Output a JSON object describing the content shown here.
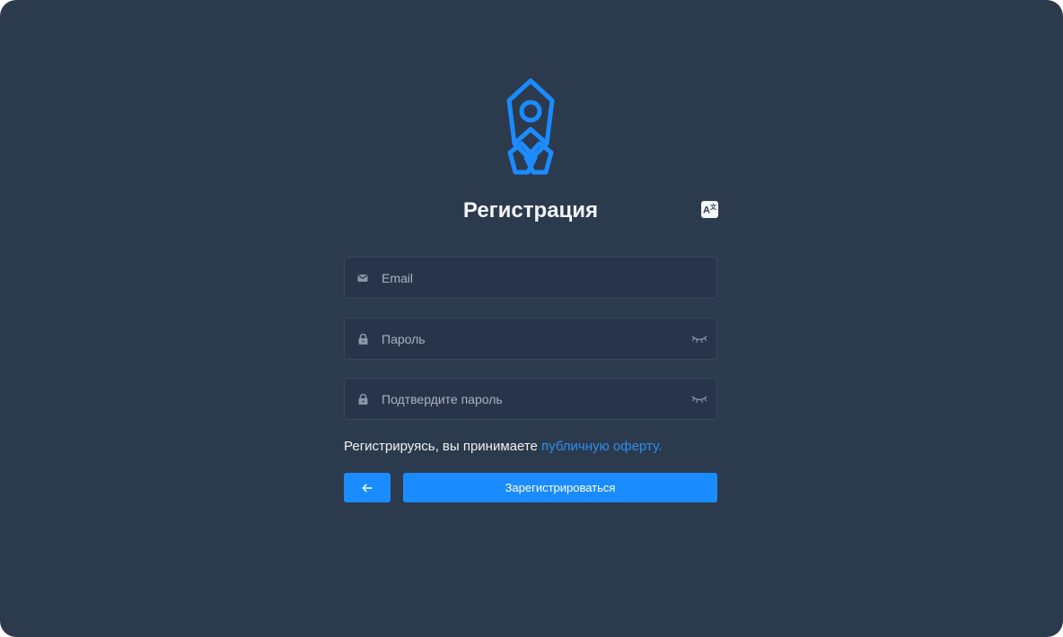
{
  "brand": {
    "logo_icon": "rocket-icon",
    "accent_color": "#1a8cff"
  },
  "header": {
    "title": "Регистрация",
    "language_button": {
      "icon": "translate-icon",
      "label": "A",
      "sup": "文"
    }
  },
  "form": {
    "email": {
      "icon": "envelope-icon",
      "placeholder": "Email",
      "value": ""
    },
    "password": {
      "icon": "lock-icon",
      "placeholder": "Пароль",
      "value": "",
      "toggle_icon": "eye-closed-icon"
    },
    "confirm_password": {
      "icon": "lock-icon",
      "placeholder": "Подтвердите пароль",
      "value": "",
      "toggle_icon": "eye-closed-icon"
    },
    "terms_text": "Регистрируясь, вы принимаете",
    "terms_link": "публичную оферту.",
    "back_button_icon": "arrow-left-icon",
    "submit_label": "Зарегистрироваться"
  }
}
